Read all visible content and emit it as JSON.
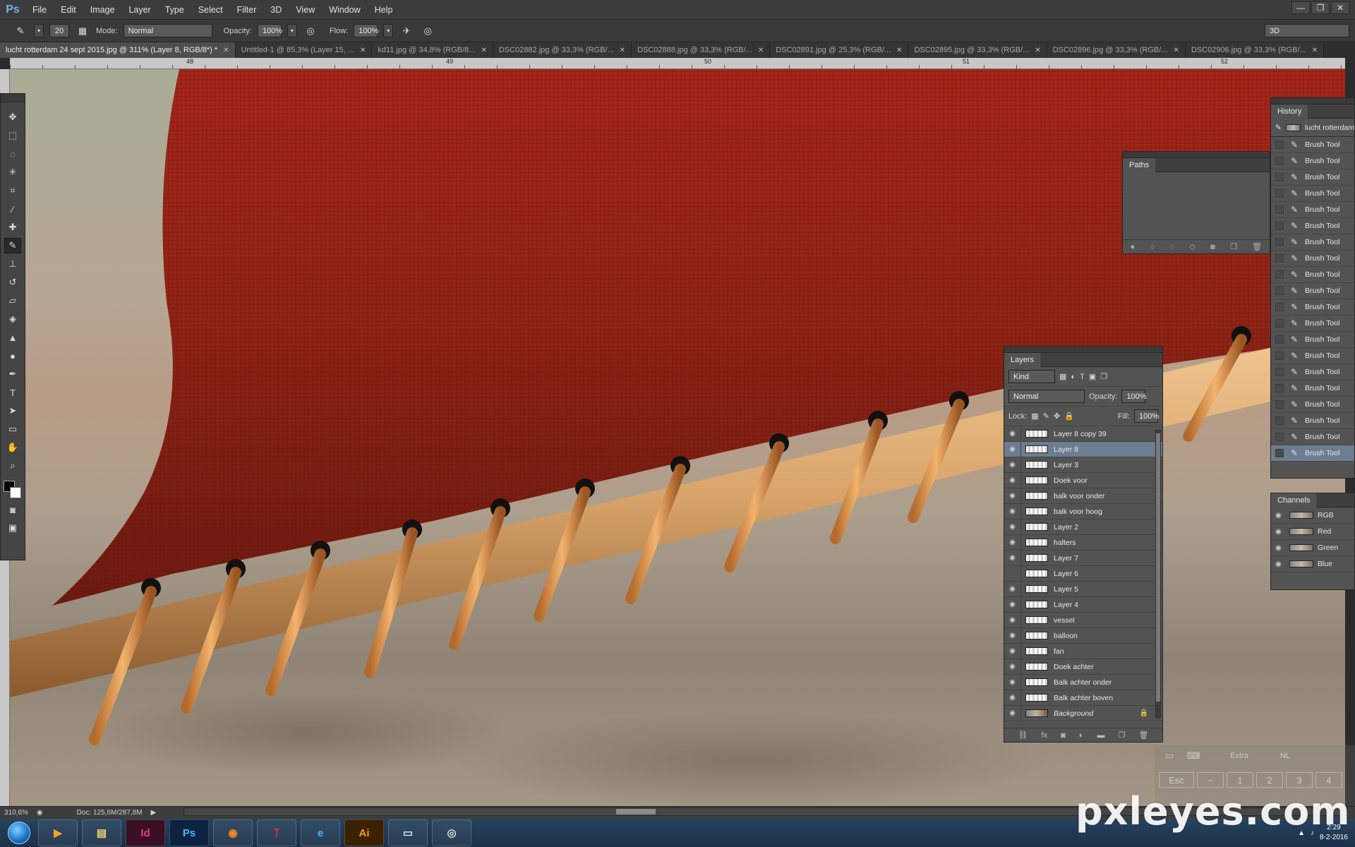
{
  "app": {
    "logo": "Ps"
  },
  "menu": [
    "File",
    "Edit",
    "Image",
    "Layer",
    "Type",
    "Select",
    "Filter",
    "3D",
    "View",
    "Window",
    "Help"
  ],
  "window_controls": [
    "—",
    "❐",
    "✕"
  ],
  "options": {
    "brush_size": "20",
    "mode_label": "Mode:",
    "mode_value": "Normal",
    "opacity_label": "Opacity:",
    "opacity_value": "100%",
    "flow_label": "Flow:",
    "flow_value": "100%",
    "workspace": "3D"
  },
  "tabs": [
    {
      "label": "lucht rotterdam 24 sept 2015.jpg @ 311% (Layer 8, RGB/8*) *",
      "active": true
    },
    {
      "label": "Untitled-1 @ 85,3% (Layer 15, ..."
    },
    {
      "label": "kd11.jpg @ 34,8% (RGB/8..."
    },
    {
      "label": "DSC02882.jpg @ 33,3% (RGB/..."
    },
    {
      "label": "DSC02888.jpg @ 33,3% (RGB/..."
    },
    {
      "label": "DSC02891.jpg @ 25,3% (RGB/..."
    },
    {
      "label": "DSC02895.jpg @ 33,3% (RGB/..."
    },
    {
      "label": "DSC02896.jpg @ 33,3% (RGB/..."
    },
    {
      "label": "DSC02906.jpg @ 33,3% (RGB/..."
    }
  ],
  "ruler_numbers": [
    "48",
    "49",
    "50",
    "51",
    "52"
  ],
  "history": {
    "title": "History",
    "snapshot": "lucht rotterdam",
    "steps": [
      "Brush Tool",
      "Brush Tool",
      "Brush Tool",
      "Brush Tool",
      "Brush Tool",
      "Brush Tool",
      "Brush Tool",
      "Brush Tool",
      "Brush Tool",
      "Brush Tool",
      "Brush Tool",
      "Brush Tool",
      "Brush Tool",
      "Brush Tool",
      "Brush Tool",
      "Brush Tool",
      "Brush Tool",
      "Brush Tool",
      "Brush Tool",
      "Brush Tool"
    ]
  },
  "paths": {
    "title": "Paths"
  },
  "layers": {
    "title": "Layers",
    "filter_kind": "Kind",
    "blend_mode": "Normal",
    "opacity_label": "Opacity:",
    "opacity_value": "100%",
    "lock_label": "Lock:",
    "fill_label": "Fill:",
    "fill_value": "100%",
    "items": [
      {
        "name": "Layer 8 copy 39",
        "visible": true
      },
      {
        "name": "Layer 8",
        "visible": true,
        "selected": true
      },
      {
        "name": "Layer 3",
        "visible": true
      },
      {
        "name": "Doek voor",
        "visible": true
      },
      {
        "name": "balk voor onder",
        "visible": true
      },
      {
        "name": "balk voor hoog",
        "visible": true
      },
      {
        "name": "Layer 2",
        "visible": true
      },
      {
        "name": "halters",
        "visible": true
      },
      {
        "name": "Layer 7",
        "visible": true
      },
      {
        "name": "Layer 6",
        "visible": false
      },
      {
        "name": "Layer 5",
        "visible": true
      },
      {
        "name": "Layer 4",
        "visible": true
      },
      {
        "name": "vessel",
        "visible": true
      },
      {
        "name": "balloon",
        "visible": true
      },
      {
        "name": "fan",
        "visible": true
      },
      {
        "name": "Doek achter",
        "visible": true
      },
      {
        "name": "Balk achter onder",
        "visible": true
      },
      {
        "name": "Balk achter boven",
        "visible": true
      },
      {
        "name": "Background",
        "visible": true,
        "locked": true,
        "background": true
      }
    ]
  },
  "channels": {
    "title": "Channels",
    "items": [
      "RGB",
      "Red",
      "Green",
      "Blue"
    ]
  },
  "status": {
    "zoom": "310,6%",
    "doc": "Doc: 125,6M/287,8M"
  },
  "keyboard": {
    "keys": [
      "Esc",
      "~",
      "1",
      "2",
      "3",
      "4"
    ],
    "extra": "Extra",
    "lang": "NL"
  },
  "taskbar": {
    "apps": [
      "media-player",
      "file-explorer",
      "InDesign",
      "Photoshop",
      "Firefox",
      "FileZilla",
      "Internet Explorer",
      "Illustrator",
      "window-switcher",
      "camera"
    ],
    "time": "2:29",
    "date": "8-2-2016"
  },
  "watermark": "pxleyes.com"
}
